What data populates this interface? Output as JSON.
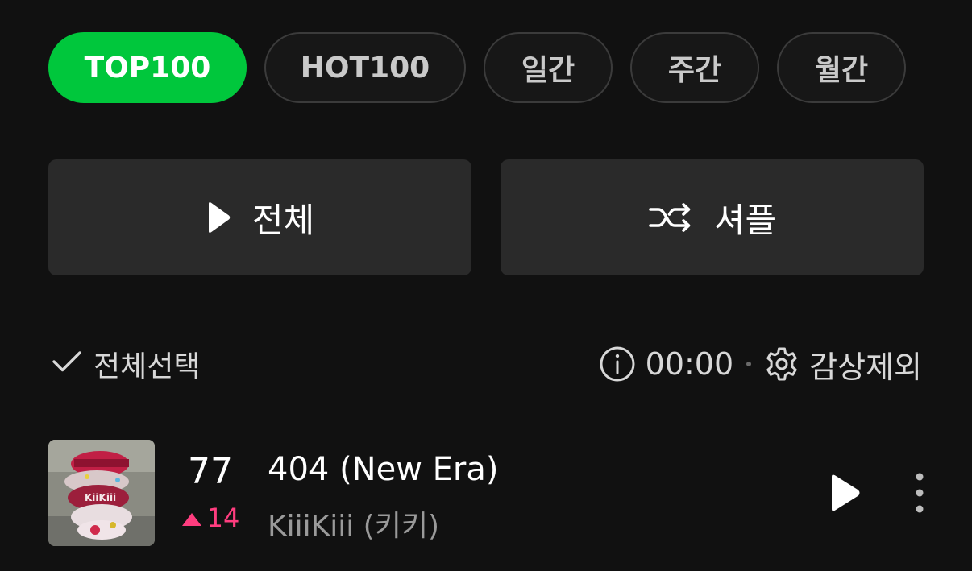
{
  "filters": {
    "top100": "TOP100",
    "hot100": "HOT100",
    "daily": "일간",
    "weekly": "주간",
    "monthly": "월간",
    "active": "TOP100",
    "active_color": "#00c73c"
  },
  "actions": {
    "play_all": {
      "label": "전체",
      "icon": "play-icon"
    },
    "shuffle": {
      "label": "셔플",
      "icon": "shuffle-icon"
    }
  },
  "toolbar": {
    "select_all": {
      "label": "전체선택",
      "icon": "check-icon"
    },
    "listening_time": {
      "icon": "info-icon",
      "value": "00:00"
    },
    "exclude": {
      "label": "감상제외",
      "icon": "gear-icon"
    }
  },
  "tracks": [
    {
      "rank": "77",
      "change_value": "14",
      "change_direction": "up",
      "change_color": "#ff3d7f",
      "title": "404 (New Era)",
      "artist": "KiiiKiii (키키)",
      "album_art_label": "KiiKiii"
    }
  ]
}
